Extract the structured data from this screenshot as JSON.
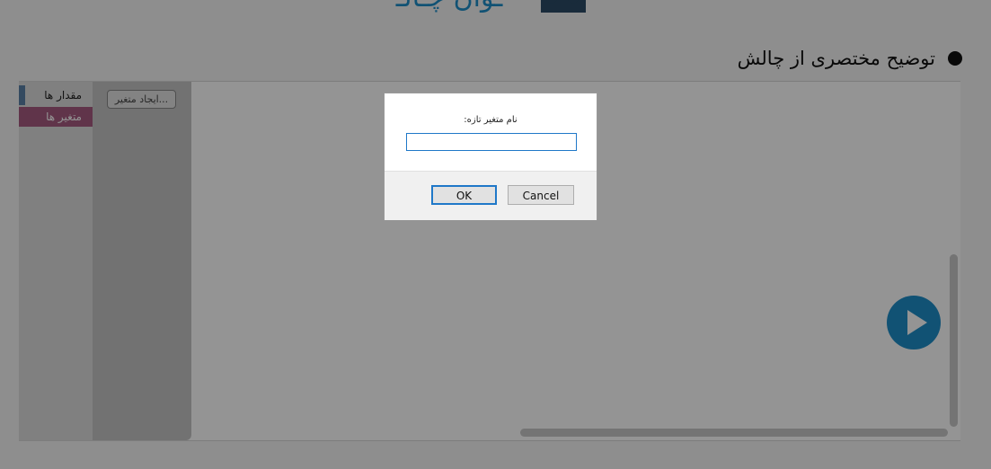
{
  "header": {
    "title_fragment": "ـوان چـالـ",
    "description_label": "توضیح مختصری از چالش"
  },
  "editor": {
    "categories": [
      {
        "label": "مقدار ها",
        "color": "#5b80a5"
      },
      {
        "label": "متغیر ها",
        "color": "#a55b80"
      }
    ],
    "create_variable_label": "...ایجاد متغیر",
    "run_icon": "play-icon"
  },
  "dialog": {
    "message": "نام متغیر تازه:",
    "input_value": "",
    "ok_label": "OK",
    "cancel_label": "Cancel",
    "accent_color": "#1f78c8"
  }
}
